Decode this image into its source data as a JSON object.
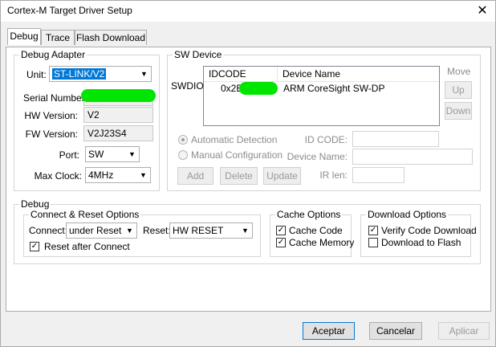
{
  "window": {
    "title": "Cortex-M Target Driver Setup",
    "close_glyph": "✕"
  },
  "tabs": [
    {
      "label": "Debug",
      "active": true
    },
    {
      "label": "Trace",
      "active": false
    },
    {
      "label": "Flash Download",
      "active": false
    }
  ],
  "debug_adapter": {
    "legend": "Debug Adapter",
    "unit_label": "Unit:",
    "unit_value": "ST-LINK/V2",
    "serial_label": "Serial Number:",
    "hw_version_label": "HW Version:",
    "hw_version_value": "V2",
    "fw_version_label": "FW Version:",
    "fw_version_value": "V2J23S4",
    "port_label": "Port:",
    "port_value": "SW",
    "max_clock_label": "Max Clock:",
    "max_clock_value": "4MHz"
  },
  "sw_device": {
    "legend": "SW Device",
    "row_label": "SWDIO",
    "columns": [
      "IDCODE",
      "Device Name"
    ],
    "rows": [
      {
        "idcode": "0x2B",
        "device_name": "ARM CoreSight SW-DP"
      }
    ],
    "move_label": "Move",
    "up_label": "Up",
    "down_label": "Down",
    "auto_detect_label": "Automatic Detection",
    "manual_config_label": "Manual Configuration",
    "id_code_label": "ID CODE:",
    "device_name_label": "Device Name:",
    "ir_len_label": "IR len:",
    "add_label": "Add",
    "delete_label": "Delete",
    "update_label": "Update"
  },
  "debug": {
    "legend": "Debug",
    "connect_reset": {
      "legend": "Connect & Reset Options",
      "connect_label": "Connect:",
      "connect_value": "under Reset",
      "reset_label": "Reset:",
      "reset_value": "HW RESET",
      "reset_after_connect_label": "Reset after Connect",
      "reset_after_connect_checked": true
    },
    "cache": {
      "legend": "Cache Options",
      "cache_code_label": "Cache Code",
      "cache_code_checked": true,
      "cache_memory_label": "Cache Memory",
      "cache_memory_checked": true
    },
    "download": {
      "legend": "Download Options",
      "verify_label": "Verify Code Download",
      "verify_checked": true,
      "download_flash_label": "Download to Flash",
      "download_flash_checked": false
    }
  },
  "footer": {
    "ok_label": "Aceptar",
    "cancel_label": "Cancelar",
    "apply_label": "Aplicar"
  },
  "colors": {
    "selection_blue": "#0078d7",
    "redaction_green": "#00e600"
  }
}
